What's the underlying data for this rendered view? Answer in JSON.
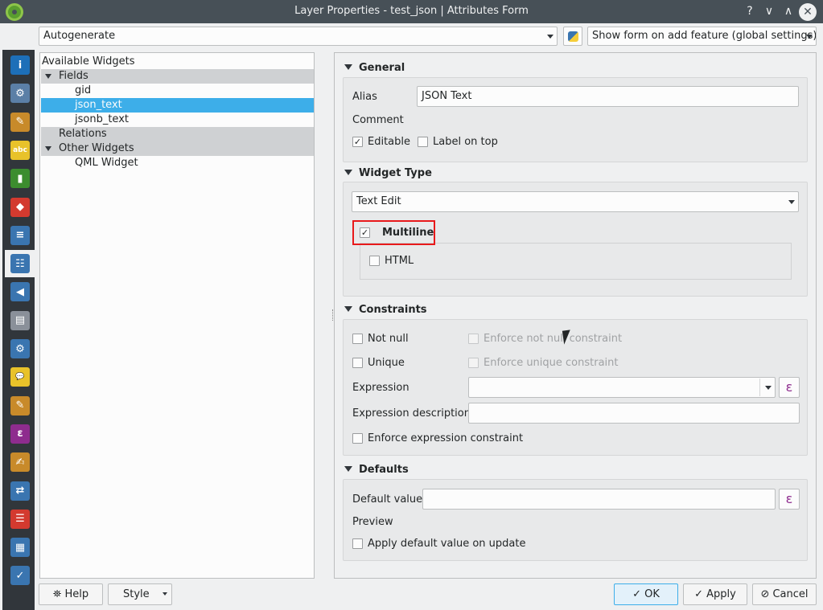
{
  "window": {
    "title": "Layer Properties - test_json | Attributes Form"
  },
  "titlebar_buttons": [
    "?",
    "∨",
    "∧",
    "✕"
  ],
  "sidebar": {
    "search_icon": "search-icon",
    "items": [
      {
        "name": "information",
        "icon": "info-icon",
        "color": "#1d6fb8",
        "glyph": "i"
      },
      {
        "name": "source",
        "icon": "wrench-icon",
        "color": "#5b7fa6",
        "glyph": "⚙"
      },
      {
        "name": "symbology",
        "icon": "brush-icon",
        "color": "#c88a2a",
        "glyph": "✎"
      },
      {
        "name": "labels",
        "icon": "labels-icon",
        "color": "#e8c22a",
        "glyph": "abc"
      },
      {
        "name": "diagrams",
        "icon": "diagram-icon",
        "color": "#3c8d2f",
        "glyph": "▮"
      },
      {
        "name": "3d-view",
        "icon": "cube-icon",
        "color": "#d33a2f",
        "glyph": "◆"
      },
      {
        "name": "fields",
        "icon": "fields-icon",
        "color": "#3a75b0",
        "glyph": "≡"
      },
      {
        "name": "attributes-form",
        "icon": "form-icon",
        "color": "#3a75b0",
        "glyph": "☷"
      },
      {
        "name": "joins",
        "icon": "joins-icon",
        "color": "#3a75b0",
        "glyph": "◀"
      },
      {
        "name": "auxiliary-storage",
        "icon": "storage-icon",
        "color": "#8a9099",
        "glyph": "▤"
      },
      {
        "name": "actions",
        "icon": "actions-icon",
        "color": "#3a75b0",
        "glyph": "⚙"
      },
      {
        "name": "display",
        "icon": "display-icon",
        "color": "#e8c22a",
        "glyph": "💬"
      },
      {
        "name": "rendering",
        "icon": "rendering-icon",
        "color": "#c88a2a",
        "glyph": "✎"
      },
      {
        "name": "variables",
        "icon": "epsilon-icon",
        "color": "#8e2c8e",
        "glyph": "ε"
      },
      {
        "name": "metadata",
        "icon": "metadata-icon",
        "color": "#c88a2a",
        "glyph": "✍"
      },
      {
        "name": "dependencies",
        "icon": "dependencies-icon",
        "color": "#3a75b0",
        "glyph": "⇄"
      },
      {
        "name": "legend",
        "icon": "legend-icon",
        "color": "#d33a2f",
        "glyph": "☰"
      },
      {
        "name": "qgis-server",
        "icon": "server-icon",
        "color": "#3a75b0",
        "glyph": "▦"
      },
      {
        "name": "digitizing",
        "icon": "digitizing-icon",
        "color": "#3a75b0",
        "glyph": "✓"
      }
    ]
  },
  "toolbar": {
    "layout_combo": "Autogenerate",
    "python_icon": "python-icon",
    "form_combo": "Show form on add feature (global settings)"
  },
  "tree": {
    "header": "Available Widgets",
    "fields_group": "Fields",
    "fields": [
      "gid",
      "json_text",
      "jsonb_text"
    ],
    "relations_group": "Relations",
    "other_group": "Other Widgets",
    "other": [
      "QML Widget"
    ]
  },
  "general": {
    "title": "General",
    "alias_label": "Alias",
    "alias_value": "JSON Text",
    "comment_label": "Comment",
    "editable_label": "Editable",
    "editable_checked": "✓",
    "label_on_top": "Label on top"
  },
  "widget_type": {
    "title": "Widget Type",
    "selected": "Text Edit",
    "multiline_label": "Multiline",
    "multiline_checked": "✓",
    "html_label": "HTML"
  },
  "constraints": {
    "title": "Constraints",
    "not_null": "Not null",
    "enforce_not_null": "Enforce not null constraint",
    "unique": "Unique",
    "enforce_unique": "Enforce unique constraint",
    "expression_label": "Expression",
    "expression_value": "",
    "expression_desc_label": "Expression description",
    "expression_desc_value": "",
    "enforce_expression": "Enforce expression constraint",
    "epsilon": "ε"
  },
  "defaults": {
    "title": "Defaults",
    "default_value_label": "Default value",
    "default_value": "",
    "preview_label": "Preview",
    "apply_on_update": "Apply default value on update",
    "epsilon": "ε"
  },
  "buttons": {
    "help": "Help",
    "style": "Style",
    "ok": "OK",
    "apply": "Apply",
    "cancel": "Cancel"
  }
}
